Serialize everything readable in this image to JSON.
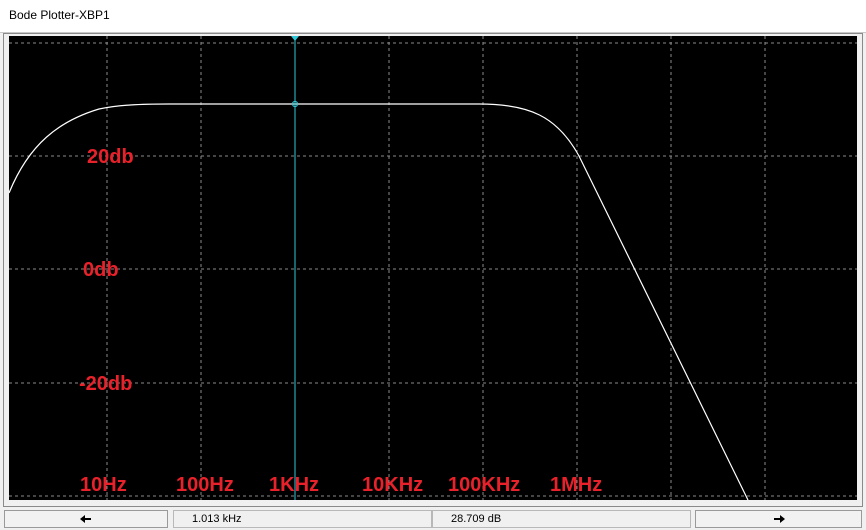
{
  "window": {
    "title": "Bode Plotter-XBP1"
  },
  "plot": {
    "background": "#000000",
    "grid_color": "#8a8a8a",
    "curve_color": "#ffffff",
    "cursor_color": "#2ec8d8",
    "label_color": "#e8212b",
    "db_labels": [
      "20db",
      "0db",
      "-20db"
    ],
    "freq_labels": [
      "10Hz",
      "100Hz",
      "1KHz",
      "10KHz",
      "100KHz",
      "1MHz"
    ]
  },
  "statusbar": {
    "left_arrow_icon": "arrow-left-icon",
    "right_arrow_icon": "arrow-right-icon",
    "frequency_readout": "1.013 kHz",
    "magnitude_readout": "28.709 dB"
  }
}
